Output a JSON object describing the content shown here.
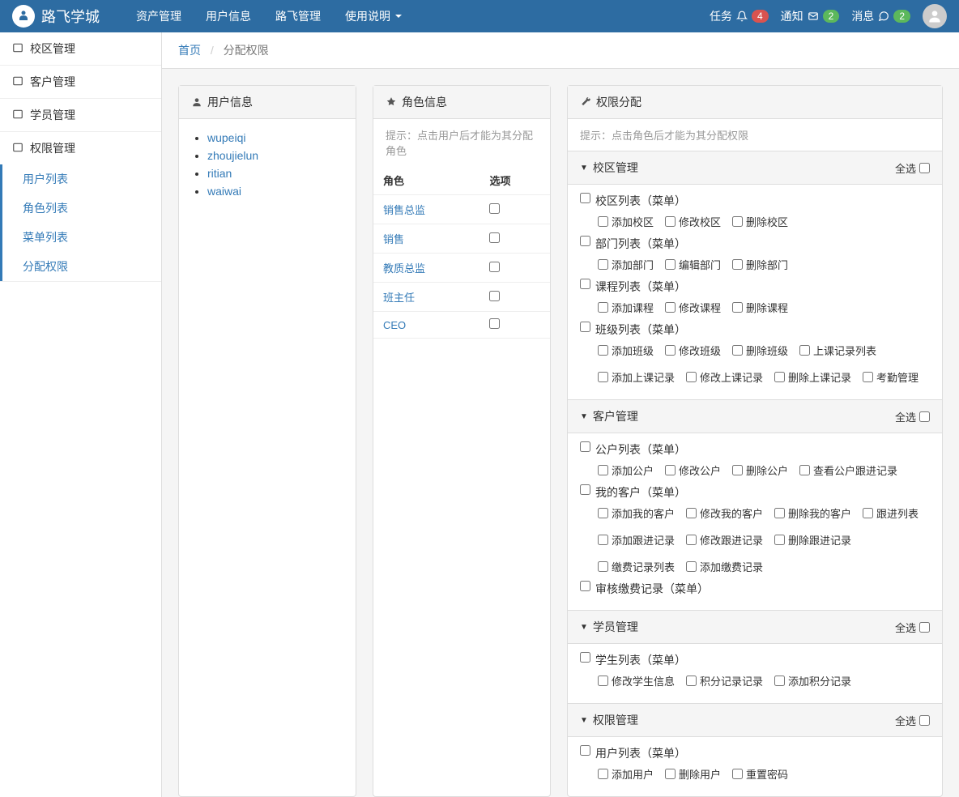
{
  "header": {
    "brand": "路飞学城",
    "nav": [
      "资产管理",
      "用户信息",
      "路飞管理",
      "使用说明"
    ],
    "tasks": {
      "label": "任务",
      "count": "4"
    },
    "notify": {
      "label": "通知",
      "count": "2"
    },
    "msg": {
      "label": "消息",
      "count": "2"
    }
  },
  "sidebar": {
    "groups": [
      {
        "label": "校区管理",
        "items": []
      },
      {
        "label": "客户管理",
        "items": []
      },
      {
        "label": "学员管理",
        "items": []
      },
      {
        "label": "权限管理",
        "items": [
          "用户列表",
          "角色列表",
          "菜单列表",
          "分配权限"
        ]
      }
    ]
  },
  "breadcrumb": {
    "home": "首页",
    "current": "分配权限"
  },
  "userPanel": {
    "title": "用户信息",
    "users": [
      "wupeiqi",
      "zhoujielun",
      "ritian",
      "waiwai"
    ]
  },
  "rolePanel": {
    "title": "角色信息",
    "hint": "提示：点击用户后才能为其分配角色",
    "th1": "角色",
    "th2": "选项",
    "roles": [
      "销售总监",
      "销售",
      "教质总监",
      "班主任",
      "CEO"
    ]
  },
  "permPanel": {
    "title": "权限分配",
    "hint": "提示：点击角色后才能为其分配权限",
    "selectAll": "全选",
    "sections": [
      {
        "title": "校区管理",
        "items": [
          {
            "name": "校区列表（菜单）",
            "children": [
              "添加校区",
              "修改校区",
              "删除校区"
            ]
          },
          {
            "name": "部门列表（菜单）",
            "children": [
              "添加部门",
              "编辑部门",
              "删除部门"
            ]
          },
          {
            "name": "课程列表（菜单）",
            "children": [
              "添加课程",
              "修改课程",
              "删除课程"
            ]
          },
          {
            "name": "班级列表（菜单）",
            "children": [
              "添加班级",
              "修改班级",
              "删除班级",
              "上课记录列表",
              "添加上课记录",
              "修改上课记录",
              "删除上课记录",
              "考勤管理"
            ]
          }
        ]
      },
      {
        "title": "客户管理",
        "items": [
          {
            "name": "公户列表（菜单）",
            "children": [
              "添加公户",
              "修改公户",
              "删除公户",
              "查看公户跟进记录"
            ]
          },
          {
            "name": "我的客户（菜单）",
            "children": [
              "添加我的客户",
              "修改我的客户",
              "删除我的客户",
              "跟进列表",
              "添加跟进记录",
              "修改跟进记录",
              "删除跟进记录",
              "缴费记录列表",
              "添加缴费记录"
            ]
          },
          {
            "name": "审核缴费记录（菜单）",
            "children": []
          }
        ]
      },
      {
        "title": "学员管理",
        "items": [
          {
            "name": "学生列表（菜单）",
            "children": [
              "修改学生信息",
              "积分记录记录",
              "添加积分记录"
            ]
          }
        ]
      },
      {
        "title": "权限管理",
        "items": [
          {
            "name": "用户列表（菜单）",
            "children": [
              "添加用户",
              "删除用户",
              "重置密码"
            ]
          }
        ]
      }
    ]
  }
}
